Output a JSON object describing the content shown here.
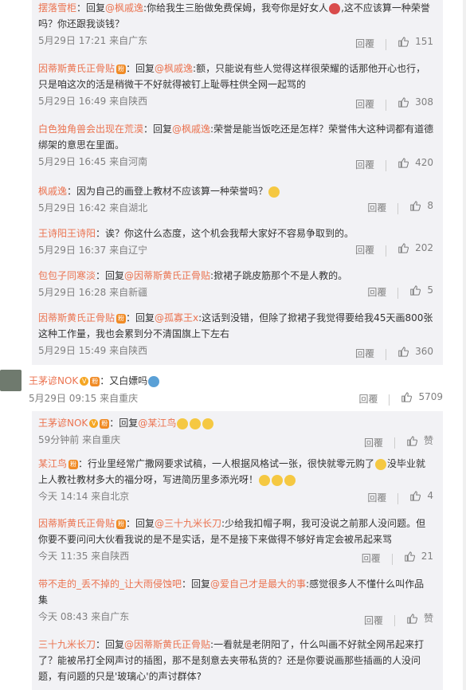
{
  "replies_a": [
    {
      "user": "摆落雪柜",
      "badges": [],
      "reply_word": "：回复",
      "at": "@枫戚逸",
      "text_line1": ":你给我生三胎做免费保姆，我夸你是好女人",
      "emoji_mid": "red",
      "text_line1b": ",这不应该算一种荣誉",
      "text_line2": "吗？你还跟我谈钱？",
      "time": "5月29日 17:21 来自广东",
      "reply_label": "回覆",
      "likes": "151"
    },
    {
      "user": "因蒂斯黄氏正骨贴",
      "badges": [
        "fan"
      ],
      "reply_word": "：回复",
      "at": "@枫戚逸",
      "text_line1": ":额，只能说有些人觉得这样很荣耀的话那他开心也行，",
      "text_line2": "只是咱这次的活是稍微干不好就得被钉上耻辱柱供全网一起骂的",
      "time": "5月29日 16:49 来自陕西",
      "reply_label": "回覆",
      "likes": "308"
    },
    {
      "user": "白色独角兽会出现在荒漠",
      "badges": [],
      "reply_word": "：回复",
      "at": "@枫戚逸",
      "text_line1": ":荣誉是能当饭吃还是怎样？荣誉伟大这种词都有道德",
      "text_line2": "绑架的意思在里面。",
      "time": "5月29日 16:45 来自河南",
      "reply_label": "回覆",
      "likes": "420"
    },
    {
      "user": "枫戚逸",
      "badges": [],
      "text_line1": "：因为自己的画登上教材不应该算一种荣誉吗？",
      "time": "5月29日 16:42 来自湖北",
      "reply_label": "回覆",
      "likes": "8"
    },
    {
      "user": "王诗阳王诗阳",
      "badges": [],
      "text_line1": "：诶？你这什么态度，这个机会我帮大家好不容易争取到的。",
      "time": "5月29日 16:37 来自辽宁",
      "reply_label": "回覆",
      "likes": "202"
    },
    {
      "user": "包包子同寒淡",
      "badges": [],
      "reply_word": "：回复",
      "at": "@因蒂斯黄氏正骨贴",
      "text_line1": ":掀裙子跳皮筋那个不是人教的。",
      "time": "5月29日 16:28 来自新疆",
      "reply_label": "回覆",
      "likes": "5"
    },
    {
      "user": "因蒂斯黄氏正骨贴",
      "badges": [
        "fan"
      ],
      "reply_word": "：回复",
      "at": "@孤寡王x",
      "text_line1": ":这话到没错，但除了掀裙子我觉得要给我45天画800张",
      "text_line2": "这种工作量，我也会累到分不清国旗上下左右",
      "time": "5月29日 15:49 来自陕西",
      "reply_label": "回覆",
      "likes": "360"
    }
  ],
  "top_comment": {
    "user": "王茅谚NOK",
    "text": "：又白嫖吗",
    "time": "5月29日 09:15 来自重庆",
    "reply_label": "回覆",
    "likes": "5709"
  },
  "replies_b": [
    {
      "user": "王茅谚NOK",
      "reply_word": "：回复",
      "at": "@某江鸟",
      "time": "59分钟前 来自重庆",
      "reply_label": "回覆",
      "likes": "赞"
    },
    {
      "user": "某江鸟",
      "text_line1": "：行业里经常广撒网要求试稿，一人根据风格试一张，很快就零元购了",
      "text_line1b": "没毕业就",
      "text_line2": "上人教社教材多大的福分呀，写进简历里多添光呀！",
      "time": "今天 14:14 来自北京",
      "reply_label": "回覆",
      "likes": "4"
    },
    {
      "user": "因蒂斯黄氏正骨贴",
      "reply_word": "：回复",
      "at": "@三十九米长刀",
      "text_line1": ":少给我扣帽子啊，我可没说之前那人没问题。但",
      "text_line2": "你要不要问问大伙看我说的是不是实话，是不是接下来做得不够好肯定会被吊起来骂",
      "time": "今天 11:35 来自陕西",
      "reply_label": "回覆",
      "likes": "21"
    },
    {
      "user": "带不走的_丢不掉的_让大雨侵蚀吧",
      "reply_word": "：回复",
      "at": "@爱自己才是最大的事",
      "text_line1": ":感觉很多人不懂什么叫作品",
      "text_line2": "集",
      "time": "今天 08:43 来自广东",
      "reply_label": "回覆",
      "likes": "赞"
    },
    {
      "user": "三十九米长刀",
      "reply_word": "：回复",
      "at": "@因蒂斯黄氏正骨贴",
      "text_line1": ":一看就是老阴阳了，什么叫画不好就全网吊起来打",
      "text_line2": "了？能被吊打全网声讨的插图，那不是刻意去夹带私货的？还是你要说画那些插画的人没问",
      "text_line3": "题，有问题的只是'玻璃心'的声讨群体?"
    }
  ]
}
